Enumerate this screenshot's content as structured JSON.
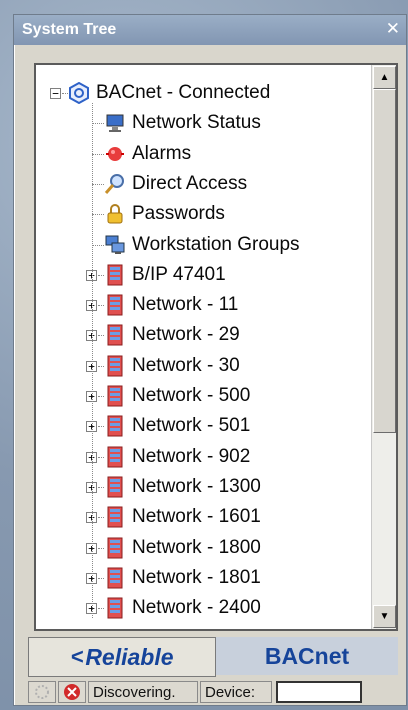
{
  "window": {
    "title": "System Tree",
    "close_glyph": "✕"
  },
  "tree": {
    "root": {
      "label": "BACnet - Connected",
      "toggle": "−",
      "icon": "bacnet-icon"
    },
    "children": [
      {
        "label": "Network Status",
        "icon": "monitor-icon"
      },
      {
        "label": "Alarms",
        "icon": "alarm-icon"
      },
      {
        "label": "Direct Access",
        "icon": "magnifier-icon"
      },
      {
        "label": "Passwords",
        "icon": "padlock-icon"
      },
      {
        "label": "Workstation Groups",
        "icon": "workstation-group-icon"
      },
      {
        "label": "B/IP 47401",
        "icon": "network-icon",
        "toggle": "+"
      },
      {
        "label": "Network - 11",
        "icon": "network-icon",
        "toggle": "+"
      },
      {
        "label": "Network - 29",
        "icon": "network-icon",
        "toggle": "+"
      },
      {
        "label": "Network - 30",
        "icon": "network-icon",
        "toggle": "+"
      },
      {
        "label": "Network - 500",
        "icon": "network-icon",
        "toggle": "+"
      },
      {
        "label": "Network - 501",
        "icon": "network-icon",
        "toggle": "+"
      },
      {
        "label": "Network - 902",
        "icon": "network-icon",
        "toggle": "+"
      },
      {
        "label": "Network - 1300",
        "icon": "network-icon",
        "toggle": "+"
      },
      {
        "label": "Network - 1601",
        "icon": "network-icon",
        "toggle": "+"
      },
      {
        "label": "Network - 1800",
        "icon": "network-icon",
        "toggle": "+"
      },
      {
        "label": "Network - 1801",
        "icon": "network-icon",
        "toggle": "+"
      },
      {
        "label": "Network - 2400",
        "icon": "network-icon",
        "toggle": "+"
      }
    ]
  },
  "scrollbar": {
    "up": "▲",
    "down": "▼"
  },
  "tabs": {
    "reliable": "Reliable",
    "bacnet": "BACnet"
  },
  "status": {
    "text": "Discovering.",
    "device_label": "Device:",
    "device_value": ""
  },
  "colors": {
    "title_bar": "#8fa3bf",
    "tab_text": "#16449a",
    "network_icon": "#d94444"
  }
}
